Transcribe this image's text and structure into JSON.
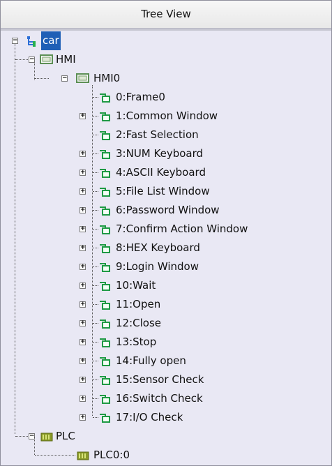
{
  "header": {
    "title": "Tree View"
  },
  "tree": {
    "root": {
      "label": "car"
    },
    "hmi": {
      "label": "HMI"
    },
    "hmi0": {
      "label": "HMI0"
    },
    "windows": [
      {
        "label": "0:Frame0",
        "expandable": false
      },
      {
        "label": "1:Common Window",
        "expandable": true
      },
      {
        "label": "2:Fast Selection",
        "expandable": false
      },
      {
        "label": "3:NUM Keyboard",
        "expandable": true
      },
      {
        "label": "4:ASCII Keyboard",
        "expandable": true
      },
      {
        "label": "5:File List Window",
        "expandable": true
      },
      {
        "label": "6:Password Window",
        "expandable": true
      },
      {
        "label": "7:Confirm Action Window",
        "expandable": true
      },
      {
        "label": "8:HEX Keyboard",
        "expandable": true
      },
      {
        "label": "9:Login Window",
        "expandable": true
      },
      {
        "label": "10:Wait",
        "expandable": true
      },
      {
        "label": "11:Open",
        "expandable": true
      },
      {
        "label": "12:Close",
        "expandable": true
      },
      {
        "label": "13:Stop",
        "expandable": true
      },
      {
        "label": "14:Fully open",
        "expandable": true
      },
      {
        "label": "15:Sensor Check",
        "expandable": true
      },
      {
        "label": "16:Switch Check",
        "expandable": true
      },
      {
        "label": "17:I/O Check",
        "expandable": true
      }
    ],
    "plc": {
      "label": "PLC"
    },
    "plc0": {
      "label": "PLC0:0"
    }
  }
}
